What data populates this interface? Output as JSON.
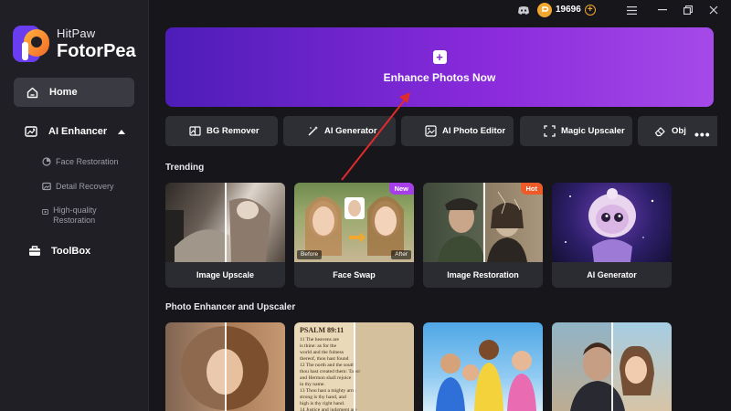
{
  "app": {
    "brand_small": "HitPaw",
    "brand_big": "FotorPea",
    "brand_color": "#7b2bd6"
  },
  "titlebar": {
    "coins": "19696",
    "icons": [
      "discord-icon",
      "coin-icon",
      "add-coin-icon",
      "menu-icon",
      "minimize-icon",
      "restore-icon",
      "close-icon"
    ]
  },
  "sidebar": {
    "home": "Home",
    "ai_enhancer": "AI Enhancer",
    "sub_items": [
      {
        "label": "Face Restoration",
        "icon": "face-restoration-icon"
      },
      {
        "label": "Detail Recovery",
        "icon": "detail-recovery-icon"
      },
      {
        "label": "High-quality Restoration",
        "icon": "high-quality-restoration-icon"
      }
    ],
    "toolbox": "ToolBox"
  },
  "hero": {
    "label": "Enhance Photos Now"
  },
  "tools": [
    {
      "label": "BG Remover",
      "icon": "bg-remover-icon"
    },
    {
      "label": "AI Generator",
      "icon": "ai-generator-icon"
    },
    {
      "label": "AI Photo Editor",
      "icon": "photo-editor-icon"
    },
    {
      "label": "Magic Upscaler",
      "icon": "upscaler-icon"
    },
    {
      "label": "Obj",
      "icon": "eraser-icon"
    }
  ],
  "trending": {
    "title": "Trending",
    "cards": [
      {
        "label": "Image Upscale",
        "badge": ""
      },
      {
        "label": "Face Swap",
        "badge": "New",
        "before": "Before",
        "after": "After"
      },
      {
        "label": "Image Restoration",
        "badge": "Hot"
      },
      {
        "label": "AI Generator",
        "badge": ""
      }
    ]
  },
  "enhancer": {
    "title": "Photo Enhancer and Upscaler",
    "psalm": "PSALM 89:11",
    "psalm_lines": [
      "11 The heavens are",
      "is thine: as for the",
      "world and the fulness",
      "thereof, thou hast found",
      "12 The north and the south",
      "thou hast created them: Tabor",
      "and Hermon shall rejoice",
      "in thy name.",
      "13 Thou hast a mighty arm:",
      "strong is thy hand, and",
      "high is thy right hand.",
      "14 Justice and judgment are"
    ]
  }
}
